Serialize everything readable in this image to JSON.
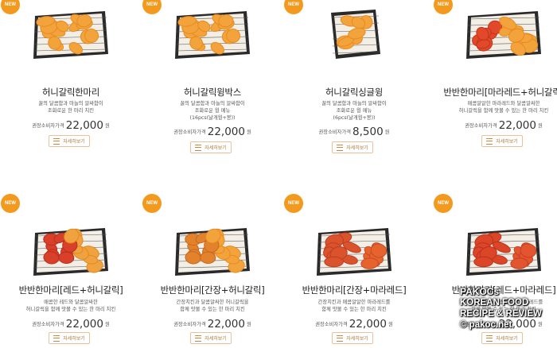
{
  "badge_label": "NEW",
  "detail_label": "자세히보기",
  "price_label": "권장소비자가격",
  "price_unit": "원",
  "products": [
    {
      "name": "허니갈릭한마리",
      "desc": [
        "꿀의 달콤함과 마늘의 알싸함이",
        "조화로운 한 마리 치킨"
      ],
      "price": "22,000",
      "style": "honey"
    },
    {
      "name": "허니갈릭윙박스",
      "desc": [
        "꿀의 달콤함과 마늘의 알싸함이",
        "조화로운 윙 메뉴",
        "(16pcs(날개윙+봉))"
      ],
      "price": "22,000",
      "style": "honey"
    },
    {
      "name": "허니갈릭싱글윙",
      "desc": [
        "꿀의 달콤함과 마늘의 알싸함이",
        "조화로운 윙 메뉴",
        "(6pcs(날개윙+봉))"
      ],
      "price": "8,500",
      "style": "honey-small"
    },
    {
      "name": "반반한마리[마라레드+허니갈릭]",
      "desc": [
        "매콤알알한 마라레드와 달콤알싸한",
        "허니갈릭을 함께 맛볼 수 있는 한 마리 치킨"
      ],
      "price": "22,000",
      "style": "half-mara"
    },
    {
      "name": "반반한마리[레드+허니갈릭]",
      "desc": [
        "매콤한 레드와 달콤알싸한",
        "허니갈릭을 함께 맛볼 수 있는 한 마리 치킨"
      ],
      "price": "22,000",
      "style": "half-red"
    },
    {
      "name": "반반한마리[간장+허니갈릭]",
      "desc": [
        "간장치킨과 달콤알싸한 허니갈릭을",
        "함께 맛볼 수 있는 한 마리 치킨"
      ],
      "price": "22,000",
      "style": "half-soy"
    },
    {
      "name": "반반한마리[간장+마라레드]",
      "desc": [
        "간장치킨과 매콤알알한 마라레드를",
        "함께 맛볼 수 있는 한 마리 치킨"
      ],
      "price": "22,000",
      "style": "half-soy-mara"
    },
    {
      "name": "반반한마리[레드+마라레드]",
      "desc": [
        "매콤한 레드와 매콤알알한 마라레드를",
        "함께 맛볼 수 있는 한 마리 치킨"
      ],
      "price": "22,000",
      "style": "half-red-mara"
    }
  ],
  "watermark": {
    "line1": "PAKOCs",
    "line2": "KOREAN FOOD",
    "line3": "RECIPE & REVIEW",
    "line4": "© pakoc.net"
  }
}
